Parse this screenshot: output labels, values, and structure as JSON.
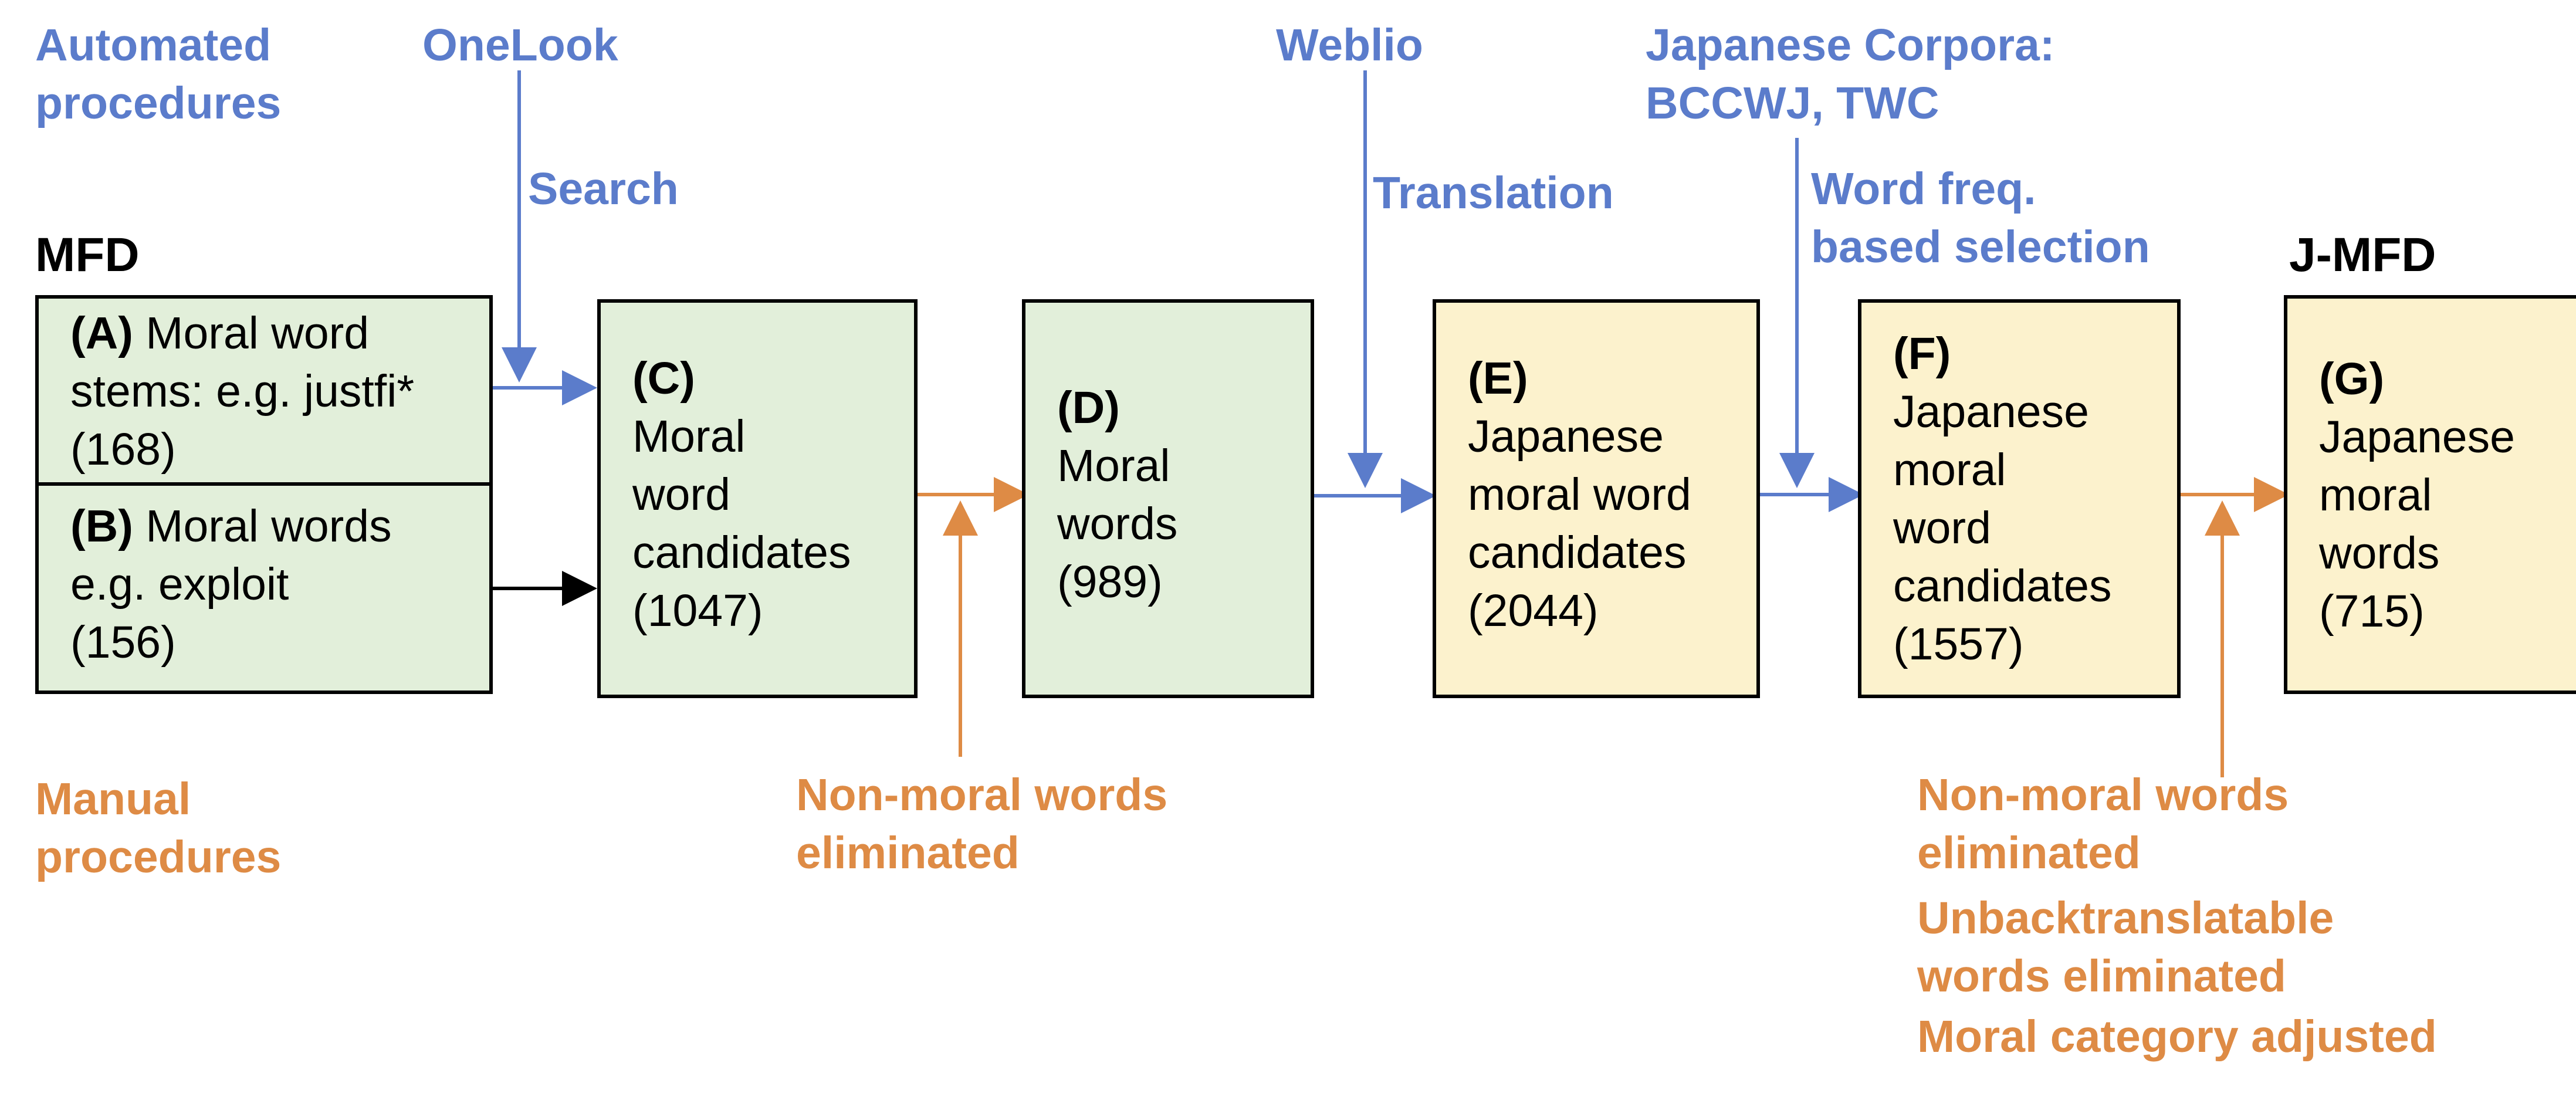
{
  "colors": {
    "automated": "#5b7ccb",
    "manual": "#de8b45",
    "green_box": "#e2efda",
    "yellow_box": "#fcf2cd"
  },
  "legend": {
    "automated": [
      "Automated",
      "procedures"
    ],
    "manual": [
      "Manual",
      "procedures"
    ]
  },
  "headers": {
    "mfd": "MFD",
    "jmfd": "J-MFD"
  },
  "sources": {
    "onelook": "OneLook",
    "search": "Search",
    "weblio": "Weblio",
    "translation": "Translation",
    "corpora": [
      "Japanese Corpora:",
      "BCCWJ, TWC"
    ],
    "wordfreq": [
      "Word freq.",
      "based selection"
    ]
  },
  "boxes": {
    "A": {
      "id": "(A)",
      "lines": [
        "Moral word",
        "stems: e.g. justfi*",
        "(168)"
      ]
    },
    "B": {
      "id": "(B)",
      "lines": [
        "Moral words",
        "e.g. exploit",
        "(156)"
      ]
    },
    "C": {
      "id": "(C)",
      "lines": [
        "Moral",
        "word",
        "candidates",
        "(1047)"
      ]
    },
    "D": {
      "id": "(D)",
      "lines": [
        "Moral",
        "words",
        "(989)"
      ]
    },
    "E": {
      "id": "(E)",
      "lines": [
        "Japanese",
        "moral word",
        "candidates",
        "(2044)"
      ]
    },
    "F": {
      "id": "(F)",
      "lines": [
        "Japanese",
        "moral",
        "word",
        "candidates",
        "(1557)"
      ]
    },
    "G": {
      "id": "(G)",
      "lines": [
        "Japanese",
        "moral",
        "words",
        "(715)"
      ]
    }
  },
  "manual_notes": {
    "cd": [
      "Non-moral words",
      "eliminated"
    ],
    "fg": [
      "Non-moral words",
      "eliminated",
      "Unbacktranslatable",
      "words eliminated",
      "Moral category adjusted"
    ]
  }
}
